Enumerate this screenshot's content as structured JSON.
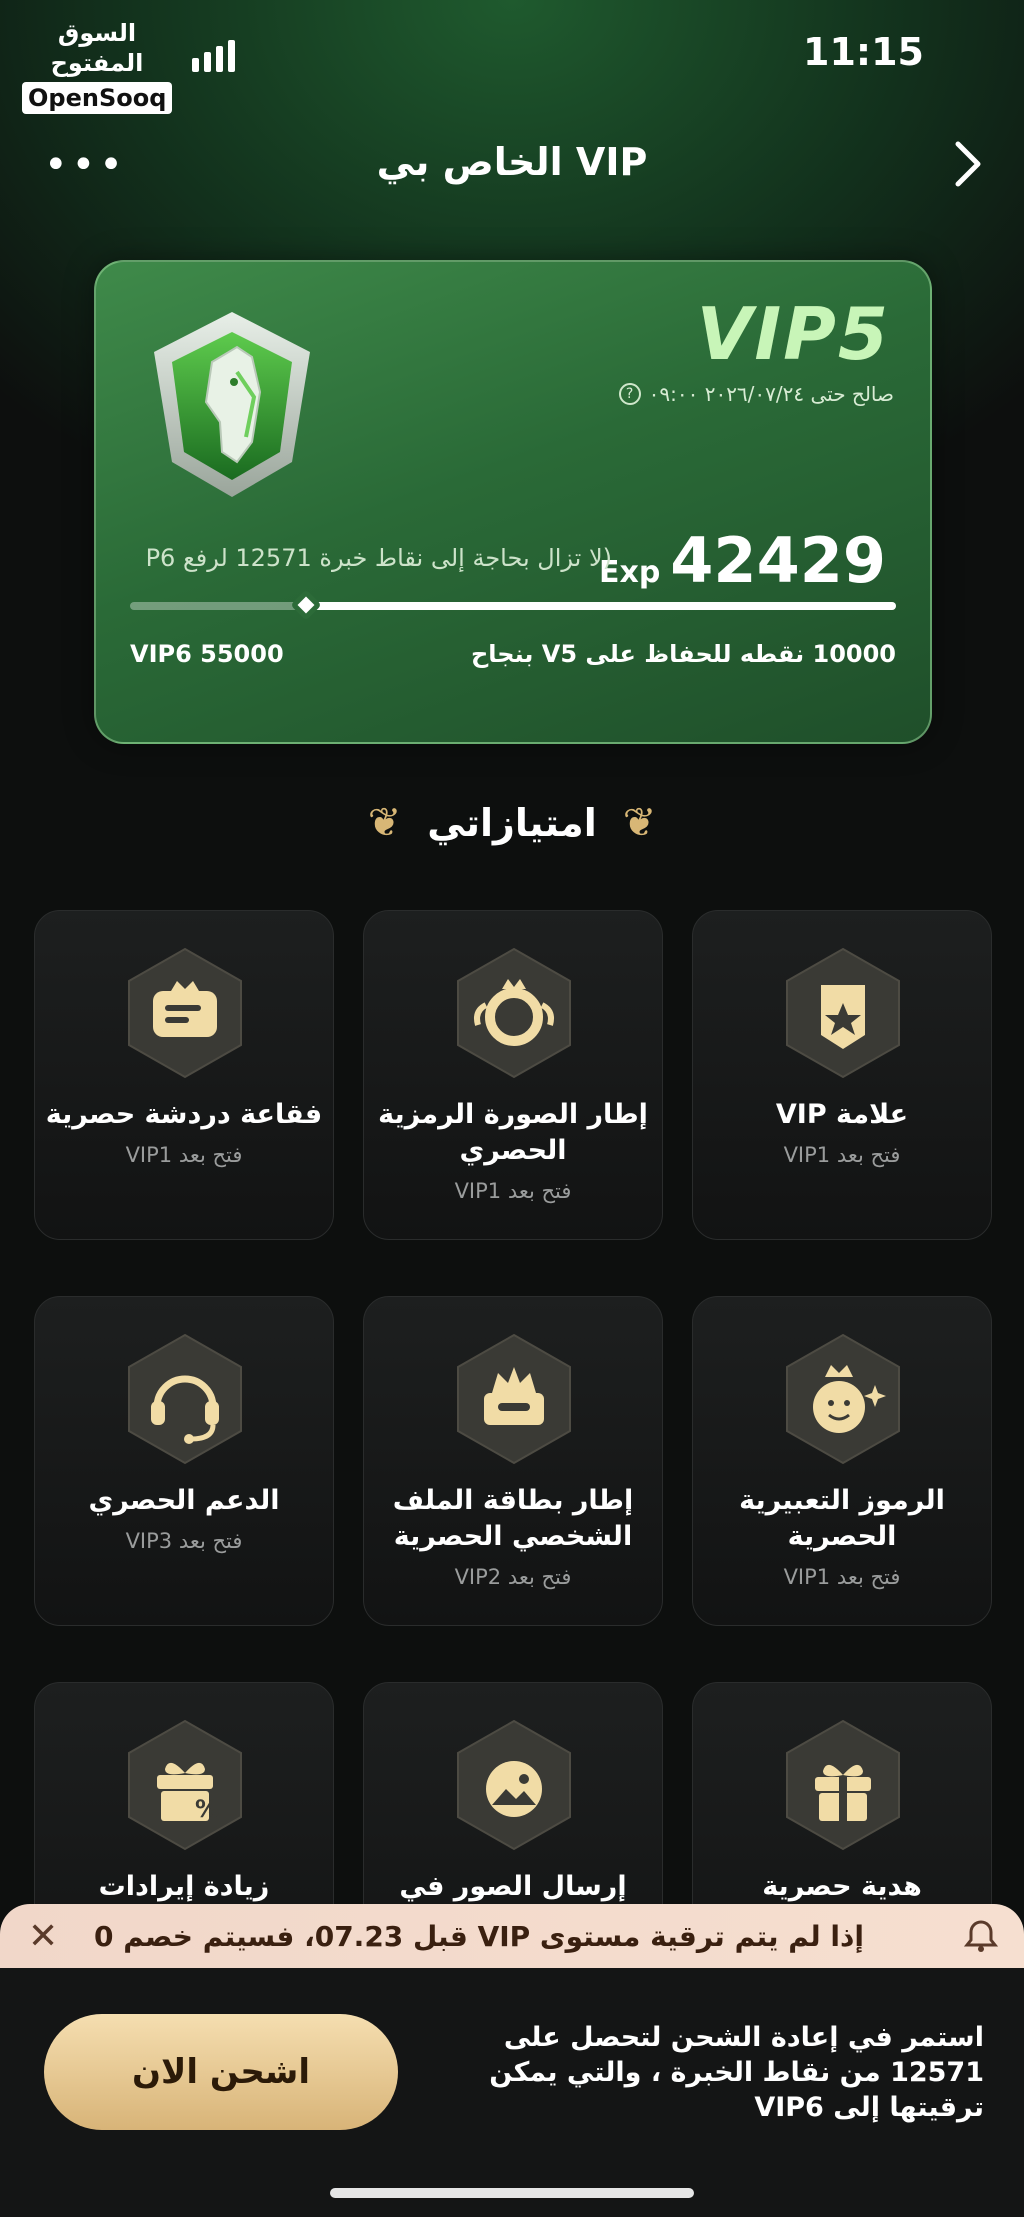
{
  "status": {
    "time": "11:15",
    "watermark_ar": "السوق المفتوح",
    "watermark_en": "OpenSooq"
  },
  "nav": {
    "title": "VIP الخاص بي",
    "more": "•••"
  },
  "card": {
    "level": "VIP5",
    "valid_until": "صالح حتى ٢٠٢٦/٠٧/٢٤ ٠٩:٠٠",
    "exp_value": "42429",
    "exp_label": "Exp",
    "exp_note": "(لا تزال بحاجة إلى نقاط خبرة 12571 لرفع P6",
    "progress": 0.77,
    "maintain": "10000 نقطه للحفاظ على V5 بنجاح",
    "next_vip": "VIP6 55000"
  },
  "privileges_title": "امتيازاتي",
  "tiles": [
    {
      "title": "علامة VIP",
      "sub": "فتح بعد VIP1",
      "icon": "badge-star-icon"
    },
    {
      "title": "إطار الصورة الرمزية الحصري",
      "sub": "فتح بعد VIP1",
      "icon": "avatar-frame-icon"
    },
    {
      "title": "فقاعة دردشة حصرية",
      "sub": "فتح بعد VIP1",
      "icon": "chat-bubble-icon"
    },
    {
      "title": "الرموز التعبيرية الحصرية",
      "sub": "فتح بعد VIP1",
      "icon": "emoji-crown-icon"
    },
    {
      "title": "إطار بطاقة الملف الشخصي الحصرية",
      "sub": "فتح بعد VIP2",
      "icon": "profile-card-frame-icon"
    },
    {
      "title": "الدعم الحصري",
      "sub": "فتح بعد VIP3",
      "icon": "headset-icon"
    },
    {
      "title": "هدية حصرية",
      "sub": "",
      "icon": "gift-icon"
    },
    {
      "title": "إرسال الصور في",
      "sub": "",
      "icon": "image-send-icon"
    },
    {
      "title": "زيادة إيرادات",
      "sub": "",
      "icon": "gift-percent-icon"
    }
  ],
  "promo": {
    "text": "إذا لم يتم ترقية مستوى VIP قبل 07.23، فسيتم خصم 0",
    "close": "✕"
  },
  "recharge": {
    "text": "استمر في إعادة الشحن لتحصل على 12571 من نقاط الخبرة ، والتي يمكن ترقيتها إلى VIP6",
    "button": "اشحن الان"
  },
  "colors": {
    "accent_gold": "#d8b478",
    "card_green": "#2a6a37",
    "vip_text": "#c8f5b8"
  }
}
